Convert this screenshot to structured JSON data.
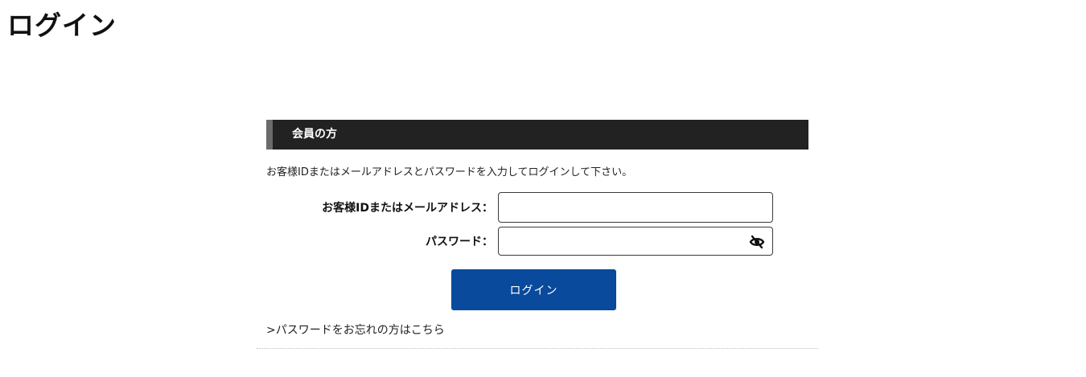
{
  "page": {
    "title": "ログイン"
  },
  "member": {
    "header": "会員の方",
    "instruction": "お客様IDまたはメールアドレスとパスワードを入力してログインして下さい。",
    "id_label": "お客様IDまたはメールアドレス：",
    "id_value": "",
    "password_label": "パスワード：",
    "password_value": "",
    "password_toggle_icon": "eye-slash-icon",
    "login_button": "ログイン",
    "forgot_link": ">パスワードをお忘れの方はこちら"
  },
  "colors": {
    "header_bg": "#222222",
    "header_accent": "#6b6b6b",
    "button_bg": "#0a4a9c",
    "text": "#222222"
  }
}
